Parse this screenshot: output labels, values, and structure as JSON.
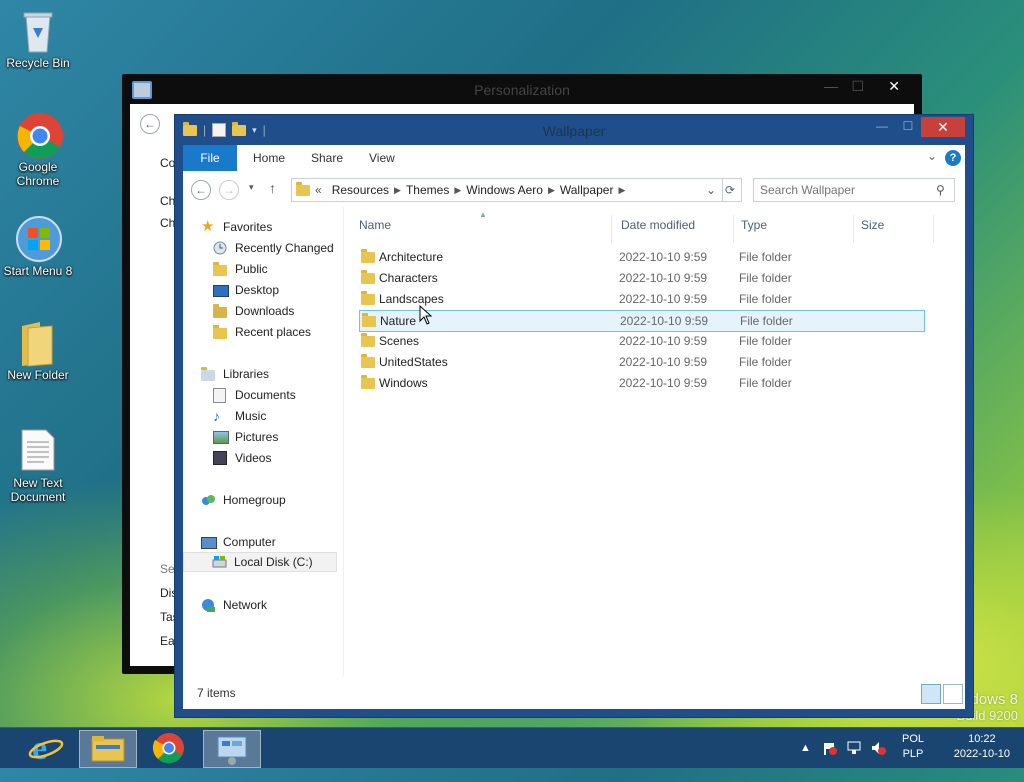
{
  "desktop": {
    "icons": [
      {
        "label": "Recycle Bin"
      },
      {
        "label": "Google Chrome"
      },
      {
        "label": "Start Menu 8"
      },
      {
        "label": "New Folder"
      },
      {
        "label": "New Text Document"
      }
    ],
    "watermark": {
      "line1": "dows 8",
      "line2": "Build 9200"
    }
  },
  "personalization": {
    "title": "Personalization",
    "side_texts": [
      "Co",
      "Ch",
      "Ch",
      "See",
      "Dis",
      "Tas",
      "Eas"
    ]
  },
  "explorer": {
    "title": "Wallpaper",
    "ribbon_tabs": [
      "File",
      "Home",
      "Share",
      "View"
    ],
    "help_label": "?",
    "breadcrumb": [
      "Resources",
      "Themes",
      "Windows Aero",
      "Wallpaper"
    ],
    "breadcrumb_prefix": "«",
    "search_placeholder": "Search Wallpaper",
    "nav": {
      "favorites": "Favorites",
      "favorites_items": [
        "Recently Changed",
        "Public",
        "Desktop",
        "Downloads",
        "Recent places"
      ],
      "libraries": "Libraries",
      "libraries_items": [
        "Documents",
        "Music",
        "Pictures",
        "Videos"
      ],
      "homegroup": "Homegroup",
      "computer": "Computer",
      "computer_items": [
        "Local Disk (C:)"
      ],
      "network": "Network"
    },
    "columns": [
      "Name",
      "Date modified",
      "Type",
      "Size"
    ],
    "files": [
      {
        "name": "Architecture",
        "date": "2022-10-10 9:59",
        "type": "File folder"
      },
      {
        "name": "Characters",
        "date": "2022-10-10 9:59",
        "type": "File folder"
      },
      {
        "name": "Landscapes",
        "date": "2022-10-10 9:59",
        "type": "File folder"
      },
      {
        "name": "Nature",
        "date": "2022-10-10 9:59",
        "type": "File folder"
      },
      {
        "name": "Scenes",
        "date": "2022-10-10 9:59",
        "type": "File folder"
      },
      {
        "name": "UnitedStates",
        "date": "2022-10-10 9:59",
        "type": "File folder"
      },
      {
        "name": "Windows",
        "date": "2022-10-10 9:59",
        "type": "File folder"
      }
    ],
    "selected_file": "Nature",
    "status": "7 items"
  },
  "taskbar": {
    "language": {
      "line1": "POL",
      "line2": "PLP"
    },
    "clock": {
      "time": "10:22",
      "date": "2022-10-10"
    }
  },
  "colors": {
    "accent": "#1979ca",
    "close": "#c7403a",
    "selection": "#e5f3fb",
    "taskbar": "#1b4571"
  }
}
